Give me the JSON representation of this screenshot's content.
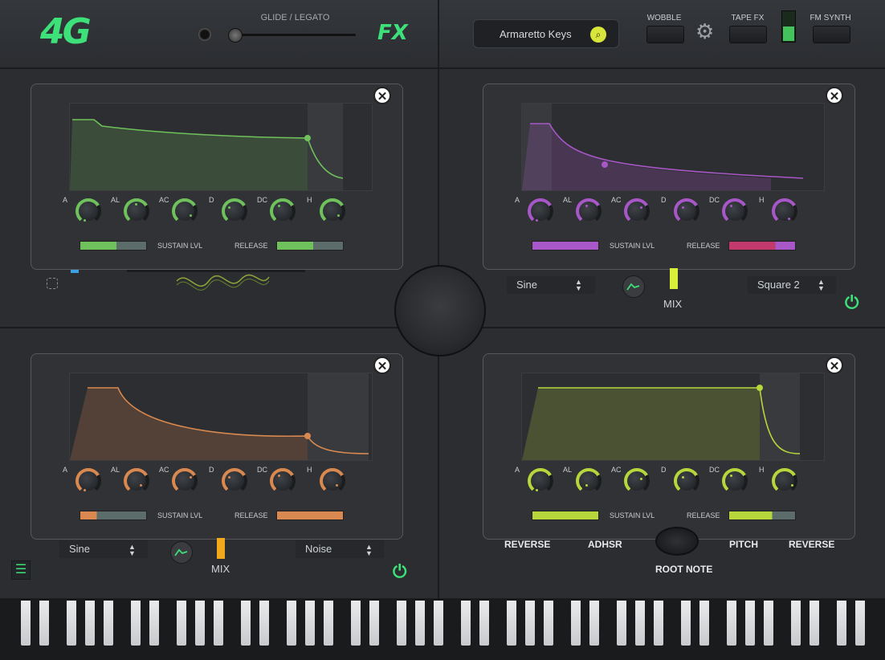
{
  "header": {
    "logo_text": "4G",
    "fx_label": "FX",
    "glide_label": "GLIDE / LEGATO",
    "preset_name": "Armaretto Keys",
    "search_glyph": "⌕",
    "wobble_label": "WOBBLE",
    "tape_fx_label": "TAPE FX",
    "fm_synth_label": "FM SYNTH",
    "gear_glyph": "⚙"
  },
  "colors": {
    "green": "#3ee07a",
    "purple": "#a857c8",
    "orange": "#d9894f",
    "lime": "#c5db45"
  },
  "panels": [
    {
      "id": "top-left",
      "knob_labels": [
        "A",
        "AL",
        "AC",
        "D",
        "DC",
        "H"
      ],
      "sustain_label": "SUSTAIN LVL",
      "release_label": "RELEASE",
      "close_glyph": "✕",
      "color": "#6fc15b",
      "sustain_fill": 0.55,
      "release_fill": 0.55
    },
    {
      "id": "top-right",
      "knob_labels": [
        "A",
        "AL",
        "AC",
        "D",
        "DC",
        "H"
      ],
      "sustain_label": "SUSTAIN LVL",
      "release_label": "RELEASE",
      "close_glyph": "✕",
      "color": "#a857c8",
      "sustain_fill": 1.0,
      "release_fill": 0.7
    },
    {
      "id": "bottom-left",
      "knob_labels": [
        "A",
        "AL",
        "AC",
        "D",
        "DC",
        "H"
      ],
      "sustain_label": "SUSTAIN LVL",
      "release_label": "RELEASE",
      "close_glyph": "✕",
      "color": "#d9894f",
      "sustain_fill": 0.25,
      "release_fill": 1.0
    },
    {
      "id": "bottom-right",
      "knob_labels": [
        "A",
        "AL",
        "AC",
        "D",
        "DC",
        "H"
      ],
      "sustain_label": "SUSTAIN LVL",
      "release_label": "RELEASE",
      "close_glyph": "✕",
      "color": "#b7d63c",
      "sustain_fill": 1.0,
      "release_fill": 0.65
    }
  ],
  "osc_top_right": {
    "wave_a": "Sine",
    "wave_b": "Square 2",
    "mix_label": "MIX",
    "mix_color": "#d8f03a"
  },
  "osc_bottom_left": {
    "wave_a": "Sine",
    "wave_b": "Noise",
    "mix_label": "MIX",
    "mix_color": "#f0a81c"
  },
  "bottom_labels": {
    "reverse_left": "REVERSE",
    "adhsr": "ADHSR",
    "root_note": "ROOT NOTE",
    "pitch": "PITCH",
    "reverse_right": "REVERSE"
  },
  "glyphs": {
    "power": "⏻",
    "menu": "☰",
    "up_down": "▲▼"
  }
}
